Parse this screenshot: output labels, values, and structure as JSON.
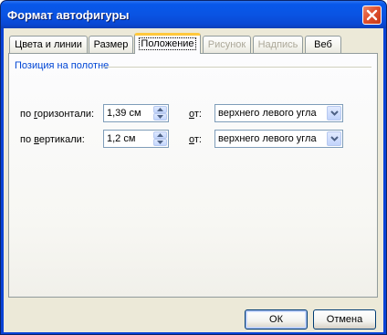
{
  "window": {
    "title": "Формат автофигуры"
  },
  "tabs": [
    {
      "label": "Цвета и линии",
      "state": "normal"
    },
    {
      "label": "Размер",
      "state": "normal"
    },
    {
      "label": "Положение",
      "state": "active"
    },
    {
      "label": "Рисунок",
      "state": "disabled"
    },
    {
      "label": "Надпись",
      "state": "disabled"
    },
    {
      "label": "Веб",
      "state": "normal"
    }
  ],
  "position_group": {
    "title": "Позиция на полотне",
    "horizontal": {
      "label_prefix": "по ",
      "label_mnemonic": "г",
      "label_rest": "оризонтали:",
      "value": "1,39 см",
      "from_mnemonic": "о",
      "from_rest": "т:",
      "from_value": "верхнего левого угла"
    },
    "vertical": {
      "label_prefix": "по ",
      "label_mnemonic": "в",
      "label_rest": "ертикали:",
      "value": "1,2 см",
      "from_mnemonic": "о",
      "from_rest": "т:",
      "from_value": "верхнего левого угла"
    }
  },
  "buttons": {
    "ok": "ОК",
    "cancel": "Отмена"
  },
  "colors": {
    "accent": "#0046d5",
    "titlebar": "#0a54e3",
    "dialog_bg": "#ece9d8"
  }
}
